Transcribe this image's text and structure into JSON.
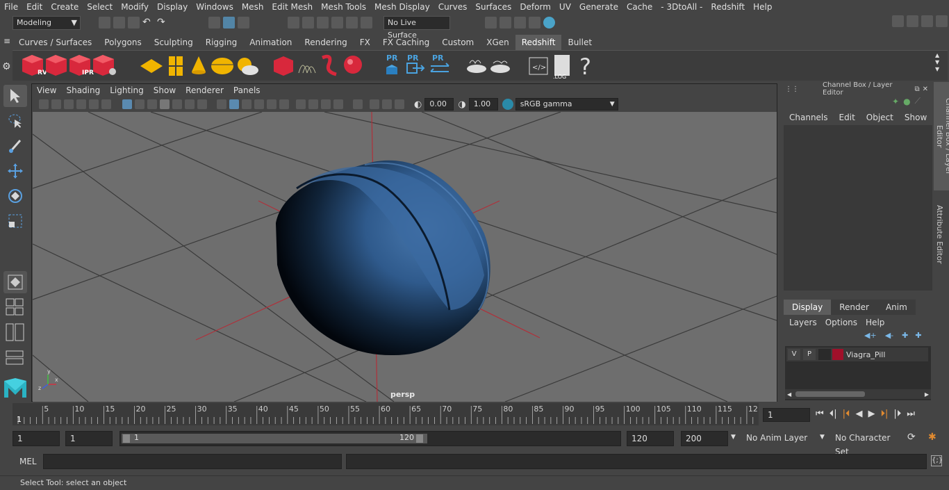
{
  "menus": [
    "File",
    "Edit",
    "Create",
    "Select",
    "Modify",
    "Display",
    "Windows",
    "Mesh",
    "Edit Mesh",
    "Mesh Tools",
    "Mesh Display",
    "Curves",
    "Surfaces",
    "Deform",
    "UV",
    "Generate",
    "Cache",
    "- 3DtoAll -",
    "Redshift",
    "Help"
  ],
  "toolbar": {
    "mode": "Modeling",
    "live_surface": "No Live Surface"
  },
  "shelf_tabs": [
    "Curves / Surfaces",
    "Polygons",
    "Sculpting",
    "Rigging",
    "Animation",
    "Rendering",
    "FX",
    "FX Caching",
    "Custom",
    "XGen",
    "Redshift",
    "Bullet"
  ],
  "active_shelf": "Redshift",
  "shelf_icons": {
    "rv": "RV",
    "ipr": "IPR",
    "pr1": "PR",
    "pr2": "PR",
    "pr3": "PR",
    "log": ".LOG",
    "help": "?"
  },
  "viewport": {
    "menus": [
      "View",
      "Shading",
      "Lighting",
      "Show",
      "Renderer",
      "Panels"
    ],
    "exposure": "0.00",
    "gamma": "1.00",
    "color_space": "sRGB gamma",
    "camera_label": "persp",
    "axis": {
      "x": "x",
      "y": "y",
      "z": "z"
    }
  },
  "channel_box": {
    "title": "Channel Box / Layer Editor",
    "menus": [
      "Channels",
      "Edit",
      "Object",
      "Show"
    ],
    "layer_tabs": [
      "Display",
      "Render",
      "Anim"
    ],
    "active_layer_tab": "Display",
    "layer_menus": [
      "Layers",
      "Options",
      "Help"
    ],
    "layer": {
      "v": "V",
      "p": "P",
      "name": "Viagra_Pill",
      "color": "#a0102a"
    }
  },
  "side_tabs": [
    "Channel Box / Layer Editor",
    "Attribute Editor"
  ],
  "timeline": {
    "ticks": [
      "5",
      "10",
      "15",
      "20",
      "25",
      "30",
      "35",
      "40",
      "45",
      "50",
      "55",
      "60",
      "65",
      "70",
      "75",
      "80",
      "85",
      "90",
      "95",
      "100",
      "105",
      "110",
      "115",
      "12"
    ],
    "start_marker": "1",
    "current_frame": "1"
  },
  "range": {
    "start": "1",
    "start2": "1",
    "slider_start": "1",
    "slider_end": "120",
    "end": "120",
    "max_end": "200",
    "anim_layer": "No Anim Layer",
    "char_set": "No Character Set"
  },
  "command": {
    "label": "MEL"
  },
  "status": "Select Tool: select an object",
  "colors": {
    "accent": "#5285a6",
    "bg": "#444444",
    "viewport": "#6e6e6e",
    "pill": "#2f5a8c"
  }
}
